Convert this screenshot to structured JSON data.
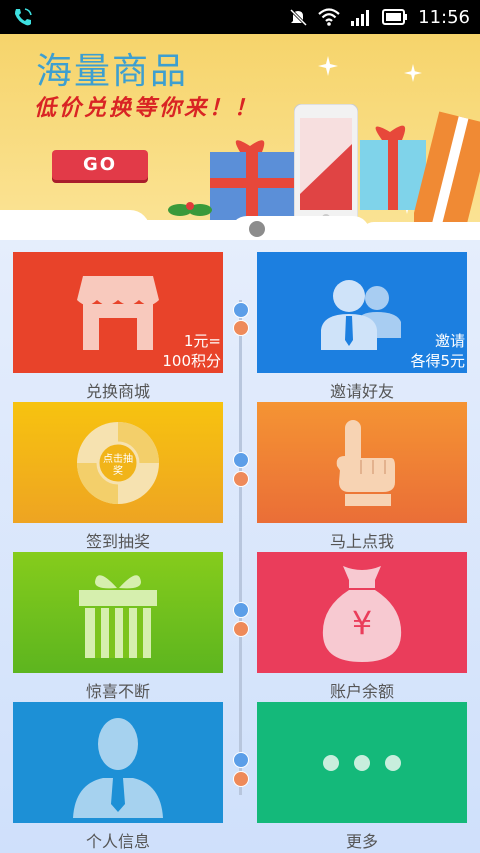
{
  "statusbar": {
    "time": "11:56"
  },
  "banner": {
    "title": "海量商品",
    "subtitle": "低价兑换等你来！！",
    "go_label": "GO"
  },
  "tiles": [
    {
      "label": "兑换商城",
      "note_line1": "1元=",
      "note_line2": "100积分",
      "color": "#e8432a",
      "icon": "shop-icon"
    },
    {
      "label": "邀请好友",
      "note_line1": "邀请",
      "note_line2": "各得5元",
      "color": "#1c7fe0",
      "icon": "users-icon"
    },
    {
      "label": "签到抽奖",
      "icon_text": "点击抽奖",
      "color": "#f3b81a",
      "icon": "lottery-wheel-icon"
    },
    {
      "label": "马上点我",
      "color": "#f07b35",
      "icon": "pointing-hand-icon"
    },
    {
      "label": "惊喜不断",
      "color": "#6cc01e",
      "icon": "gift-icon"
    },
    {
      "label": "账户余额",
      "icon_text": "¥",
      "color": "#ea3d5b",
      "icon": "money-bag-icon"
    },
    {
      "label": "个人信息",
      "color": "#1d90d6",
      "icon": "person-icon"
    },
    {
      "label": "更多",
      "color": "#14b97a",
      "icon": "more-dots-icon"
    }
  ]
}
